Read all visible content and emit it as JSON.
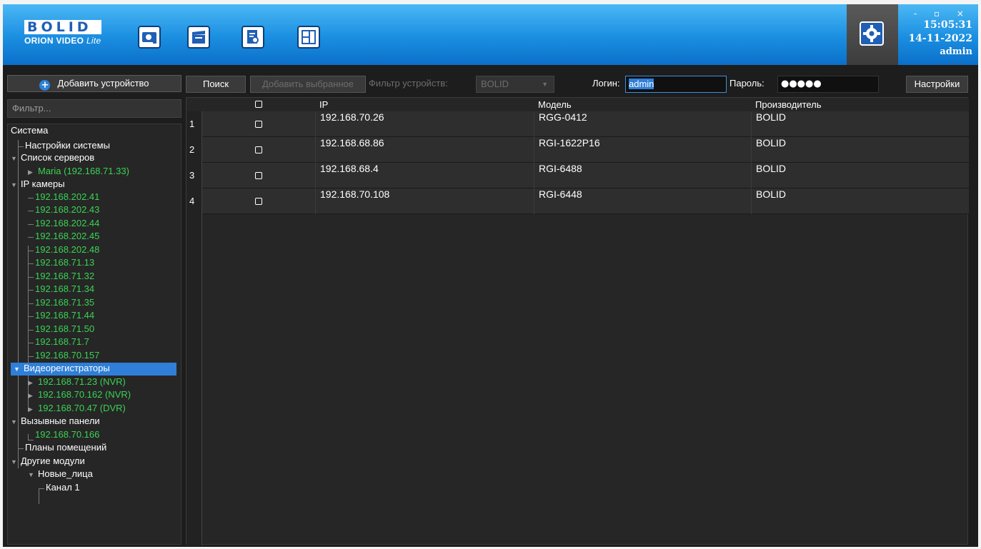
{
  "app": {
    "logo_text": "BOLID",
    "logo_sub": "ORION VIDEO",
    "logo_sub_italic": "Lite",
    "clock_time": "15:05:31",
    "clock_date": "14-11-2022",
    "user": "admin",
    "window_controls": "- ▫ ×",
    "accent": "#1a8ee0"
  },
  "toolbar_icons": [
    "camera-icon",
    "clapperboard-icon",
    "document-search-icon",
    "floor-plan-icon"
  ],
  "left": {
    "add_device_label": "Добавить устройство",
    "filter_placeholder": "Фильтр...",
    "tree": {
      "system": "Система",
      "system_settings": "Настройки системы",
      "servers": "Список серверов",
      "server_maria": "Maria (192.168.71.33)",
      "ip_cameras": "IP камеры",
      "cameras": [
        "192.168.202.41",
        "192.168.202.43",
        "192.168.202.44",
        "192.168.202.45",
        "192.168.202.48",
        "192.168.71.13",
        "192.168.71.32",
        "192.168.71.34",
        "192.168.71.35",
        "192.168.71.44",
        "192.168.71.50",
        "192.168.71.7",
        "192.168.70.157"
      ],
      "recorders": "Видеорегистраторы",
      "recorder_items": [
        "192.168.71.23 (NVR)",
        "192.168.70.162 (NVR)",
        "192.168.70.47 (DVR)"
      ],
      "call_panels": "Вызывные панели",
      "call_panel_item": "192.168.70.166",
      "floor_plans": "Планы помещений",
      "other_modules": "Другие модули",
      "new_faces": "Новые_лица",
      "channel": "Канал 1"
    }
  },
  "main": {
    "search_label": "Поиск",
    "add_selected_label": "Добавить выбранное",
    "device_filter_label": "Фильтр устройств:",
    "device_filter_value": "BOLID",
    "login_label": "Логин:",
    "login_value": "admin",
    "password_label": "Пароль:",
    "password_value": "●●●●●",
    "settings_label": "Настройки",
    "columns": [
      "IP",
      "Модель",
      "Производитель"
    ],
    "rows": [
      {
        "num": "1",
        "ip": "192.168.70.26",
        "model": "RGG-0412",
        "vendor": "BOLID"
      },
      {
        "num": "2",
        "ip": "192.168.68.86",
        "model": "RGI-1622P16",
        "vendor": "BOLID"
      },
      {
        "num": "3",
        "ip": "192.168.68.4",
        "model": "RGI-6488",
        "vendor": "BOLID"
      },
      {
        "num": "4",
        "ip": "192.168.70.108",
        "model": "RGI-6448",
        "vendor": "BOLID"
      }
    ]
  }
}
